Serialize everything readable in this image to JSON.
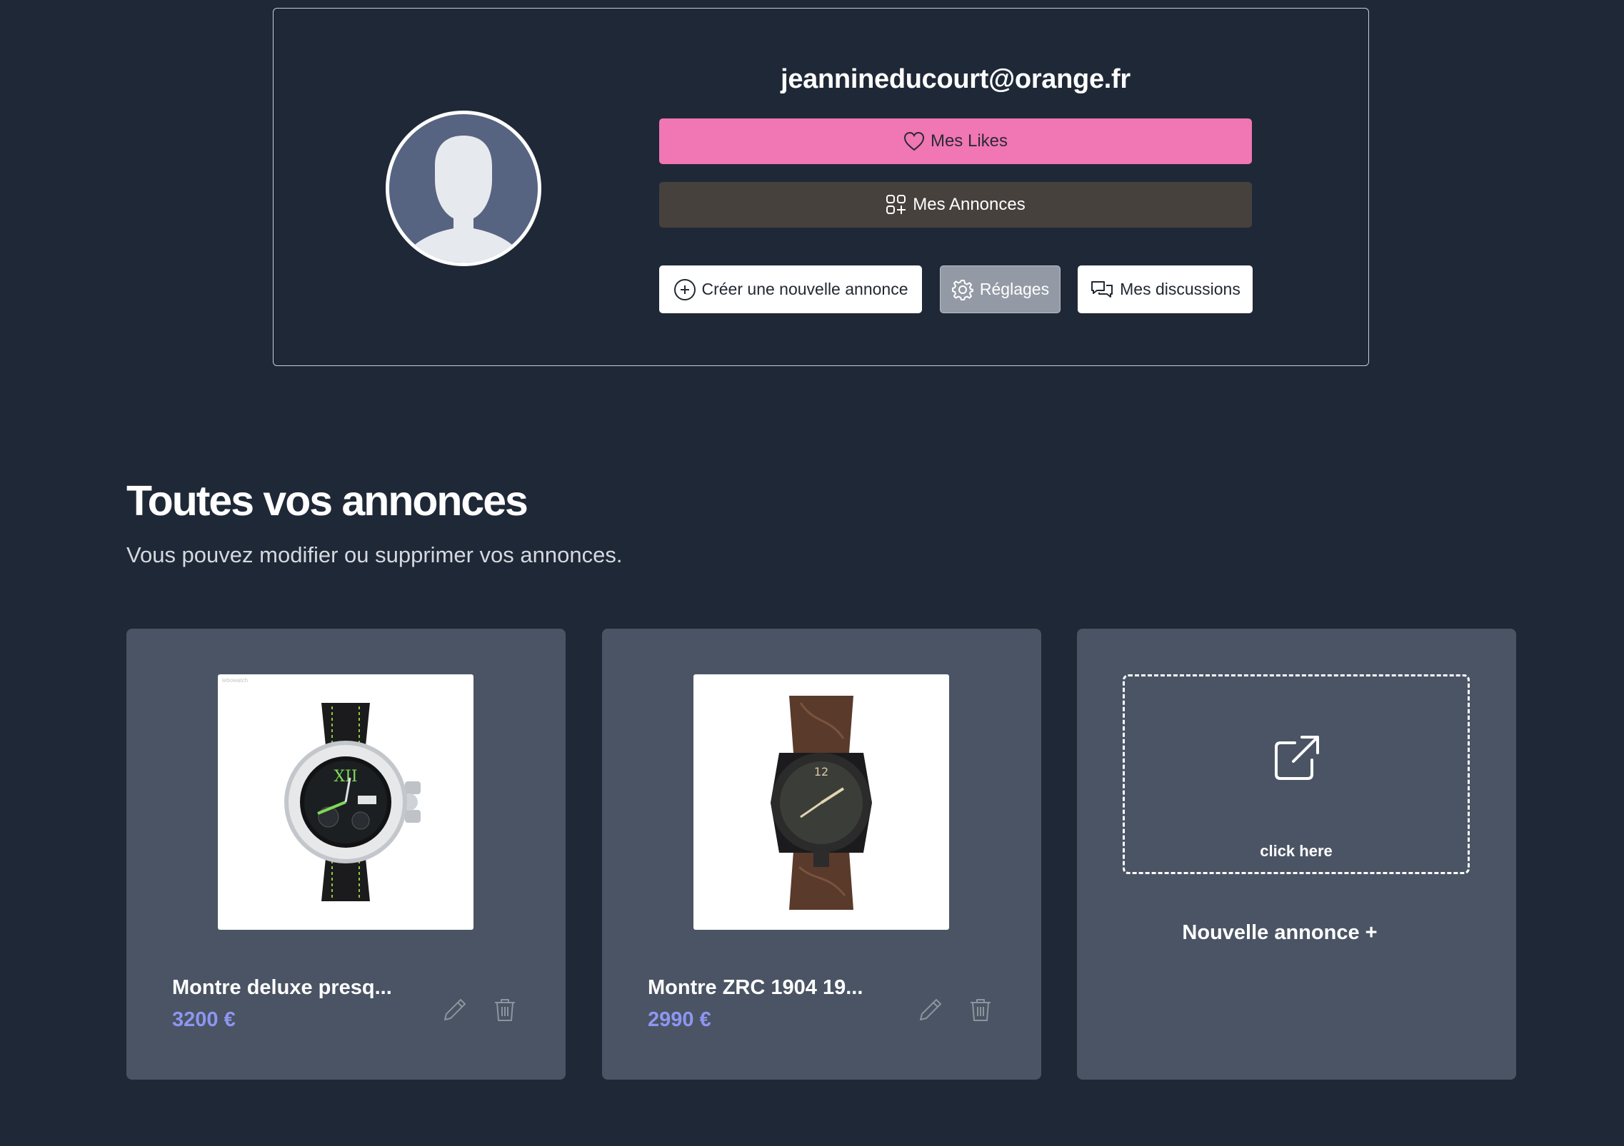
{
  "profile": {
    "email": "jeannineducourt@orange.fr",
    "likes_label": "Mes Likes",
    "annonces_label": "Mes Annonces",
    "create_label": "Créer une nouvelle annonce",
    "settings_label": "Réglages",
    "discussions_label": "Mes discussions"
  },
  "section": {
    "title": "Toutes vos annonces",
    "subtitle": "Vous pouvez modifier ou supprimer vos annonces."
  },
  "listings": [
    {
      "title": "Montre deluxe presq...",
      "price": "3200 €",
      "image": "watch-chronograph-image",
      "watermark": "lebowatch"
    },
    {
      "title": "Montre ZRC 1904 19...",
      "price": "2990 €",
      "image": "watch-leather-strap-image"
    }
  ],
  "new_listing": {
    "dropzone_label": "click here",
    "link_label": "Nouvelle annonce +"
  },
  "colors": {
    "background": "#1f2837",
    "likes": "#f076b4",
    "annonces": "#46413c",
    "settings": "#949aa5",
    "card": "#4a5464",
    "price": "#8d96f1"
  },
  "icons": [
    "heart-icon",
    "grid-plus-icon",
    "plus-circle-icon",
    "gear-icon",
    "chat-bubbles-icon",
    "pencil-icon",
    "trash-icon",
    "external-link-icon",
    "user-silhouette-icon"
  ]
}
